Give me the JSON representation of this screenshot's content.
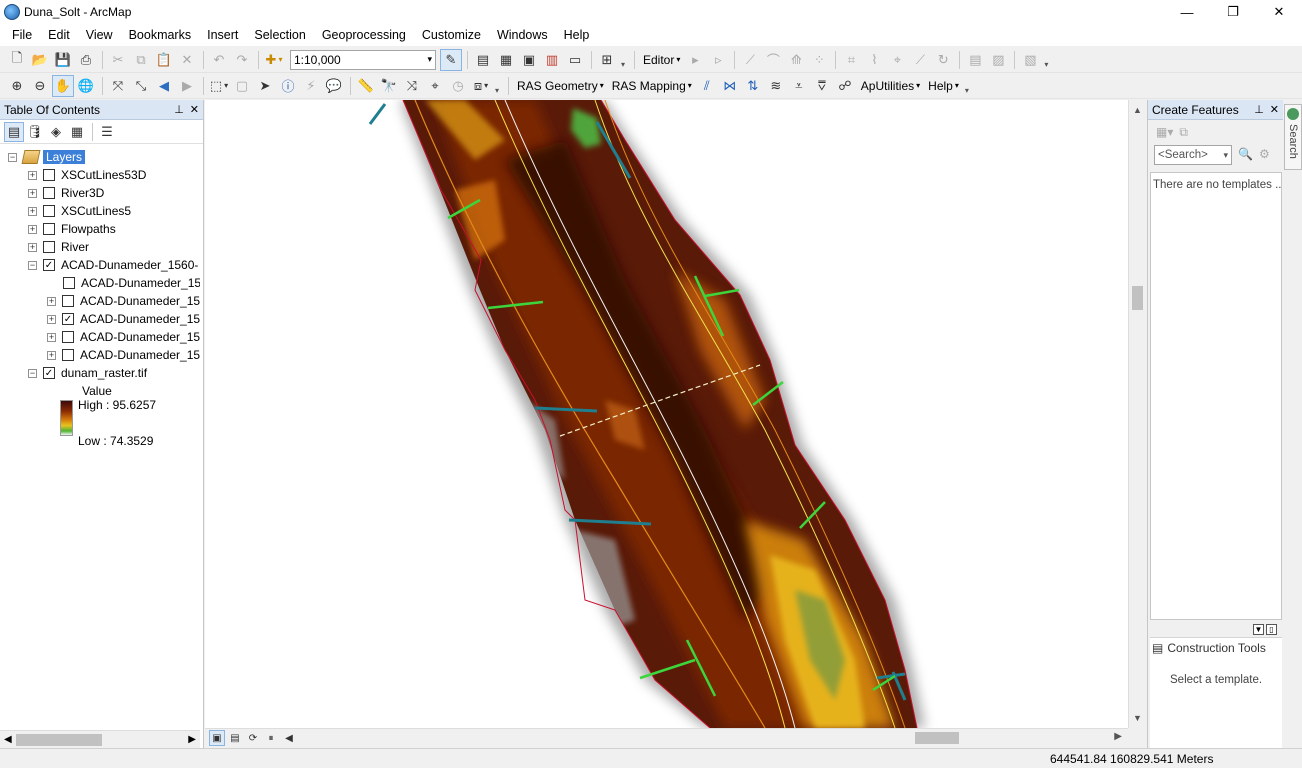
{
  "window": {
    "title": "Duna_Solt - ArcMap",
    "minimize_glyph": "—",
    "maximize_glyph": "❐",
    "close_glyph": "✕"
  },
  "menu": [
    "File",
    "Edit",
    "View",
    "Bookmarks",
    "Insert",
    "Selection",
    "Geoprocessing",
    "Customize",
    "Windows",
    "Help"
  ],
  "toolbar": {
    "scale": "1:10,000",
    "editor_label": "Editor",
    "ras_geometry_label": "RAS Geometry",
    "ras_mapping_label": "RAS Mapping",
    "aputilities_label": "ApUtilities",
    "help_label": "Help"
  },
  "toc": {
    "title": "Table Of Contents",
    "root_label": "Layers",
    "layers": [
      {
        "label": "XSCutLines53D",
        "checked": false,
        "expandable": true
      },
      {
        "label": "River3D",
        "checked": false,
        "expandable": true
      },
      {
        "label": "XSCutLines5",
        "checked": false,
        "expandable": true
      },
      {
        "label": "Flowpaths",
        "checked": false,
        "expandable": true
      },
      {
        "label": "River",
        "checked": false,
        "expandable": true
      },
      {
        "label": "ACAD-Dunameder_1560-",
        "checked": true,
        "expandable": true,
        "expanded": true
      },
      {
        "label": "ACAD-Dunameder_15",
        "checked": false,
        "expandable": false
      },
      {
        "label": "ACAD-Dunameder_15",
        "checked": false,
        "expandable": true
      },
      {
        "label": "ACAD-Dunameder_15",
        "checked": true,
        "expandable": true
      },
      {
        "label": "ACAD-Dunameder_15",
        "checked": false,
        "expandable": true
      },
      {
        "label": "ACAD-Dunameder_15",
        "checked": false,
        "expandable": true
      },
      {
        "label": "dunam_raster.tif",
        "checked": true,
        "expandable": true,
        "expanded": true
      }
    ],
    "legend": {
      "value_label": "Value",
      "high_label": "High : 95.6257",
      "low_label": "Low : 74.3529"
    }
  },
  "create_features": {
    "title": "Create Features",
    "search_placeholder": "<Search>",
    "no_templates": "There are no templates ..",
    "construction_tools_title": "Construction Tools",
    "construction_hint": "Select a template."
  },
  "search_tab": "Search",
  "status": {
    "coordinates": "644541.84  160829.541 Meters"
  },
  "colors": {
    "panel_header": "#dbe6f4",
    "selection_highlight": "#3b7fd9",
    "raster_high": "#3c0808",
    "raster_mid": "#d47a0a",
    "raster_low": "#4fb335",
    "boundary_line": "#c8102e",
    "xs_line_green": "#3cd63c",
    "xs_line_teal": "#1f7f8f"
  }
}
